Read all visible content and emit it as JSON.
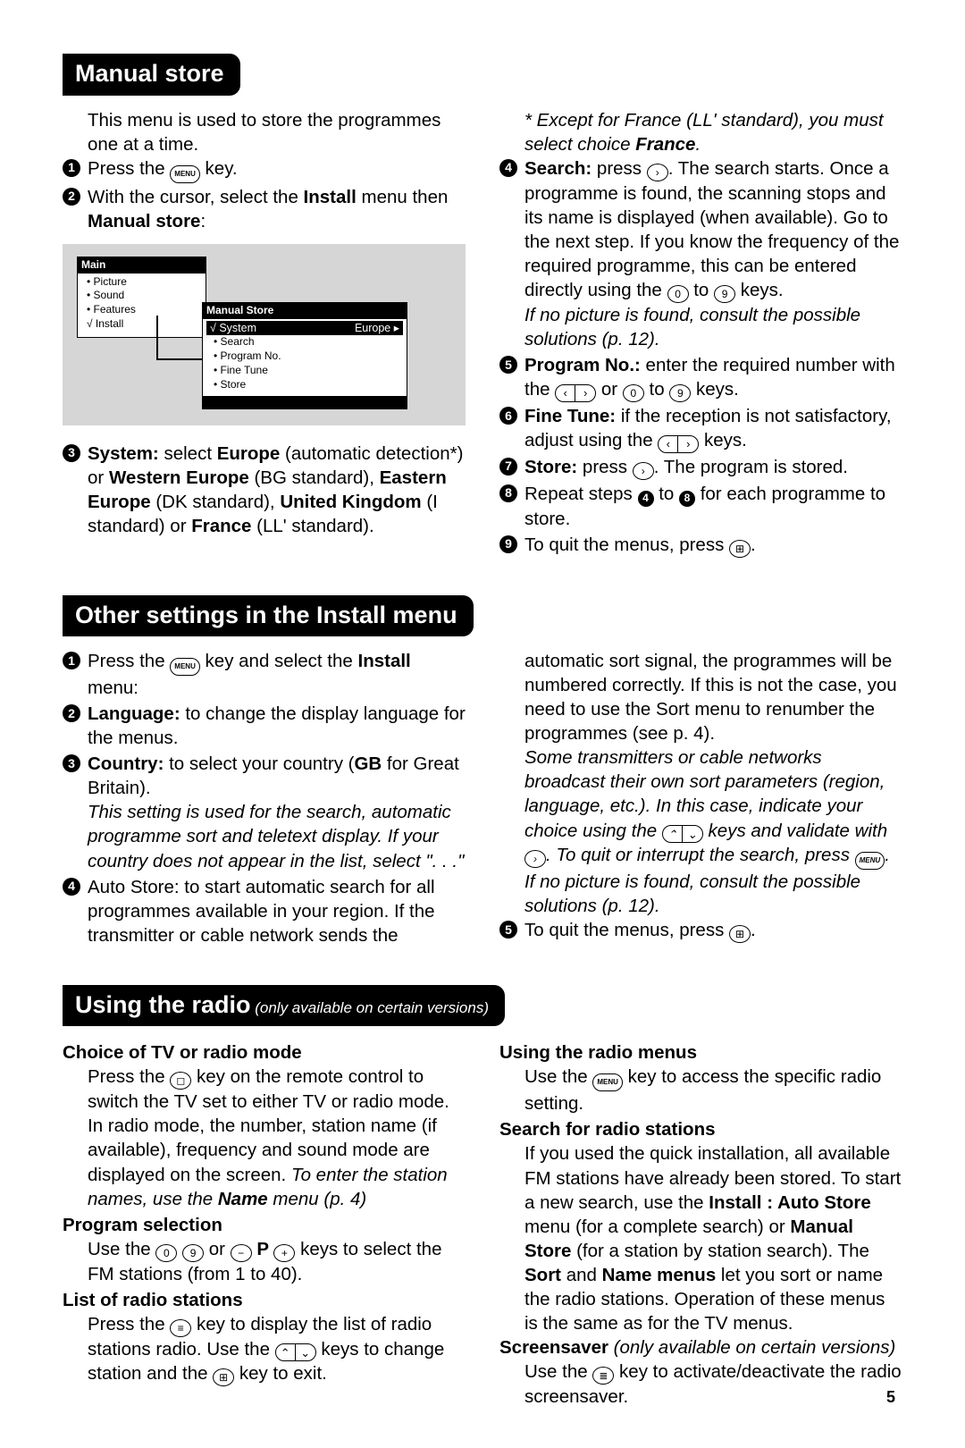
{
  "pageNumber": "5",
  "section1": {
    "title": "Manual store",
    "intro": "This menu is used to store the programmes one at a time.",
    "s1": "Press the ",
    "s1b": " key.",
    "s2a": "With the cursor, select the ",
    "s2b": "Install",
    "s2c": " menu then ",
    "s2d": "Manual store",
    "s2e": ":",
    "menu": {
      "mainTitle": "Main",
      "m1": "• Picture",
      "m2": "• Sound",
      "m3": "• Features",
      "m4": "√ Install",
      "subTitle": "Manual Store",
      "sysRow": "√ System",
      "sysVal": "Europe ▸",
      "sm1": "• Search",
      "sm2": "• Program No.",
      "sm3": "• Fine Tune",
      "sm4": "• Store"
    },
    "s3a": "System:",
    "s3b": " select ",
    "s3c": "Europe",
    "s3d": " (automatic detection*) or ",
    "s3e": "Western Europe",
    "s3f": " (BG standard), ",
    "s3g": "Eastern Europe",
    "s3h": " (DK standard), ",
    "s3i": "United Kingdom",
    "s3j": " (I standard) or ",
    "s3k": "France",
    "s3l": " (LL' standard).",
    "note_a": "* Except for France (LL' standard), you must select choice ",
    "note_b": "France",
    "note_c": ".",
    "s4a": "Search:",
    "s4b": " press ",
    "s4c": ". The search starts. Once a programme is found, the scanning stops and its name is displayed (when available). Go to the next step. If you know the frequency of the required programme, this can be entered directly using the ",
    "s4d": " to ",
    "s4e": " keys.",
    "s4note": "If no picture is found, consult the possible solutions (p. 12).",
    "s5a": "Program No.:",
    "s5b": " enter the required number with the ",
    "s5c": " or ",
    "s5d": " to ",
    "s5e": " keys.",
    "s6a": "Fine Tune:",
    "s6b": " if the reception is not satisfactory, adjust using the ",
    "s6c": " keys.",
    "s7a": "Store:",
    "s7b": " press ",
    "s7c": ". The program is stored.",
    "s8a": "Repeat steps ",
    "s8b": " to ",
    "s8c": " for each programme to store.",
    "s9a": "To quit the menus, press ",
    "s9b": "."
  },
  "section2": {
    "title": "Other settings in the Install menu",
    "s1a": "Press the ",
    "s1b": " key and select the ",
    "s1c": "Install",
    "s1d": " menu:",
    "s2a": "Language:",
    "s2b": " to change the display language for the menus.",
    "s3a": "Country:",
    "s3b": " to select your country (",
    "s3c": "GB",
    "s3d": " for Great Britain).",
    "s3note": "This setting is used for the search, automatic programme sort and teletext display. If your country does not appear in the list, select \". . .\"",
    "s4a": "Auto Store: to start automatic search for all programmes available in your region. If the transmitter or cable network sends the",
    "r4b": "automatic sort signal, the programmes will be numbered correctly. If this is not the case, you need to use the Sort menu to renumber the programmes (see p. 4).",
    "r4note_a": "Some transmitters or cable networks broadcast their own sort parameters (region, language, etc.). In this case, indicate your choice using the ",
    "r4note_b": " keys and validate with ",
    "r4note_c": ". To quit or interrupt the search, press ",
    "r4note_d": ". If no picture is found, consult the possible solutions (p. 12).",
    "s5a": "To quit the menus, press ",
    "s5b": "."
  },
  "section3": {
    "title": "Using the radio",
    "subtitle": " (only available on certain versions)",
    "h1": "Choice of TV or radio mode",
    "p1a": "Press the ",
    "p1b": " key on the remote control to switch the TV set to either TV or radio mode. In radio mode, the number, station name (if available), frequency and sound mode are displayed on the screen. ",
    "p1c": "To enter the station names, use the ",
    "p1d": "Name",
    "p1e": " menu (p. 4)",
    "h2": "Program selection",
    "p2a": "Use the ",
    "p2b": " or ",
    "p2c": " P ",
    "p2d": " keys to select the FM stations (from 1 to 40).",
    "h3": "List of radio stations",
    "p3a": "Press the ",
    "p3b": " key to display the list of radio stations radio. Use the ",
    "p3c": " keys to change station and the ",
    "p3d": " key to exit.",
    "h4": "Using the radio menus",
    "p4a": "Use the ",
    "p4b": " key to access the specific radio setting.",
    "h5": "Search for radio stations",
    "p5a": "If you used the quick installation, all available FM stations have already been stored. To start a new search, use the ",
    "p5b": "Install : Auto Store",
    "p5c": " menu (for a complete search) or ",
    "p5d": "Manual Store",
    "p5e": " (for a station by station search). The ",
    "p5f": "Sort",
    "p5g": " and ",
    "p5h": "Name menus",
    "p5i": " let you sort or name the radio stations. Operation of these menus is the same as for the TV menus.",
    "h6a": "Screensaver",
    "h6b": " (only available on certain versions)",
    "p6a": "Use the ",
    "p6b": " key to activate/deactivate the radio screensaver."
  },
  "keys": {
    "menu": "MENU",
    "zero": "0",
    "nine": "9",
    "right": "›",
    "left": "‹",
    "up": "⌃",
    "down": "⌄",
    "minus": "−",
    "plus": "+",
    "list": "≡",
    "exit": "⊞",
    "tv": "◻",
    "lines": "≣"
  }
}
